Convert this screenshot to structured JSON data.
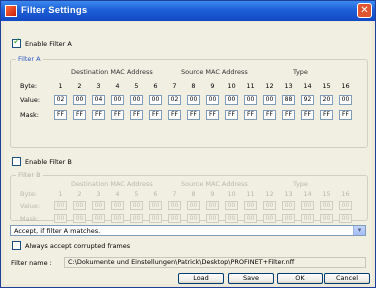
{
  "window": {
    "title": "Filter Settings",
    "close_glyph": "✕"
  },
  "filter_a": {
    "enable_label": "Enable Filter A",
    "group_label": "Filter A",
    "section_dest": "Destination MAC Address",
    "section_src": "Source MAC Address",
    "section_type": "Type",
    "row_byte": "Byte:",
    "row_value": "Value:",
    "row_mask": "Mask:",
    "byte_numbers": [
      "1",
      "2",
      "3",
      "4",
      "5",
      "6",
      "7",
      "8",
      "9",
      "10",
      "11",
      "12",
      "13",
      "14",
      "15",
      "16"
    ],
    "values": [
      "02",
      "00",
      "04",
      "00",
      "00",
      "00",
      "02",
      "00",
      "00",
      "00",
      "00",
      "00",
      "88",
      "92",
      "20",
      "00"
    ],
    "masks": [
      "FF",
      "FF",
      "FF",
      "FF",
      "FF",
      "FF",
      "FF",
      "FF",
      "FF",
      "FF",
      "FF",
      "FF",
      "FF",
      "FF",
      "FF",
      "FF"
    ]
  },
  "filter_b": {
    "enable_label": "Enable Filter B",
    "group_label": "Filter B",
    "section_dest": "Destination MAC Address",
    "section_src": "Source MAC Address",
    "section_type": "Type",
    "row_byte": "Byte:",
    "row_value": "Value:",
    "row_mask": "Mask:",
    "byte_numbers": [
      "1",
      "2",
      "3",
      "4",
      "5",
      "6",
      "7",
      "8",
      "9",
      "10",
      "11",
      "12",
      "13",
      "14",
      "15",
      "16"
    ],
    "values": [
      "00",
      "00",
      "00",
      "00",
      "00",
      "00",
      "00",
      "00",
      "00",
      "00",
      "00",
      "00",
      "00",
      "00",
      "00",
      "00"
    ],
    "masks": [
      "00",
      "00",
      "00",
      "00",
      "00",
      "00",
      "00",
      "00",
      "00",
      "00",
      "00",
      "00",
      "00",
      "00",
      "00",
      "00"
    ]
  },
  "accept_dropdown": {
    "selected": "Accept, if filter A matches."
  },
  "corrupted": {
    "label": "Always accept corrupted frames"
  },
  "filter_name": {
    "label": "Filter name :",
    "value": "C:\\Dokumente und Einstellungen\\Patrick\\Desktop\\PROFINET+Filter.nff"
  },
  "buttons": {
    "load": "Load",
    "save": "Save",
    "ok": "OK",
    "cancel": "Cancel"
  }
}
